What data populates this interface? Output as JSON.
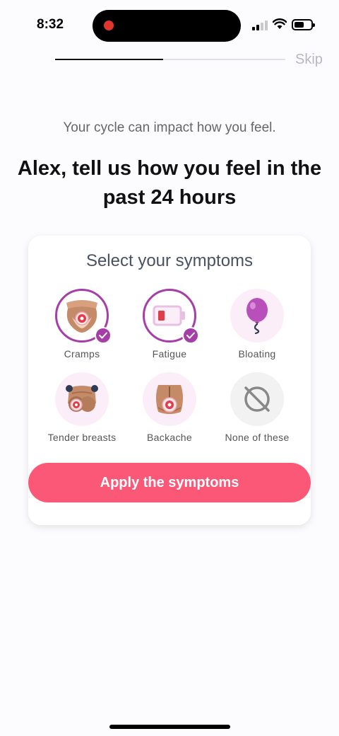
{
  "status_bar": {
    "time": "8:32"
  },
  "header": {
    "skip_label": "Skip",
    "progress": 0.47
  },
  "intro": {
    "subtitle": "Your cycle can impact how you feel.",
    "headline": "Alex, tell us how you feel in the past 24 hours"
  },
  "card": {
    "title": "Select your symptoms",
    "symptoms": [
      {
        "label": "Cramps",
        "icon": "cramps-icon",
        "selected": true
      },
      {
        "label": "Fatigue",
        "icon": "low-battery-icon",
        "selected": true
      },
      {
        "label": "Bloating",
        "icon": "balloon-icon",
        "selected": false
      },
      {
        "label": "Tender breasts",
        "icon": "tender-breasts-icon",
        "selected": false
      },
      {
        "label": "Backache",
        "icon": "backache-icon",
        "selected": false
      },
      {
        "label": "None of these",
        "icon": "none-icon",
        "selected": false
      }
    ],
    "apply_label": "Apply the symptoms"
  },
  "colors": {
    "accent": "#a63ea8",
    "button": "#fb5878",
    "icon_bg": "#fbeef8"
  }
}
